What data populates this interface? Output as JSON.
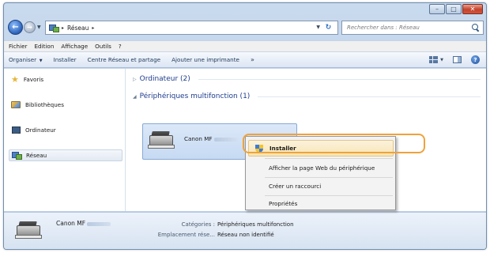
{
  "window": {
    "minimize_glyph": "–",
    "maximize_glyph": "□",
    "close_glyph": "✕"
  },
  "address": {
    "breadcrumb": [
      "Réseau"
    ],
    "separator": "▸",
    "search_placeholder": "Rechercher dans : Réseau"
  },
  "menubar": {
    "items": [
      "Fichier",
      "Edition",
      "Affichage",
      "Outils",
      "?"
    ]
  },
  "commandbar": {
    "organize": "Organiser",
    "install": "Installer",
    "network_center": "Centre Réseau et partage",
    "add_printer": "Ajouter une imprimante",
    "more": "»"
  },
  "nav": {
    "items": [
      {
        "label": "Favoris",
        "icon": "star-icon"
      },
      {
        "label": "Bibliothèques",
        "icon": "libraries-icon"
      },
      {
        "label": "Ordinateur",
        "icon": "computer-icon"
      },
      {
        "label": "Réseau",
        "icon": "network-icon",
        "selected": true
      }
    ]
  },
  "groups": {
    "computer": {
      "title": "Ordinateur (2)",
      "state": "collapsed"
    },
    "multifunction": {
      "title": "Périphériques multifonction (1)",
      "state": "expanded"
    }
  },
  "device": {
    "name": "Canon MF"
  },
  "context_menu": {
    "items": [
      "Installer",
      "Afficher la page Web du périphérique",
      "Créer un raccourci",
      "Propriétés"
    ]
  },
  "details": {
    "name": "Canon MF",
    "category_label": "Catégories :",
    "category_value": "Périphériques multifonction",
    "location_label": "Emplacement rése...",
    "location_value": "Réseau non identifié"
  },
  "colors": {
    "highlight_ring": "#f0a23a",
    "group_title": "#1e3d8c",
    "titlebar": "#b7cce6"
  }
}
